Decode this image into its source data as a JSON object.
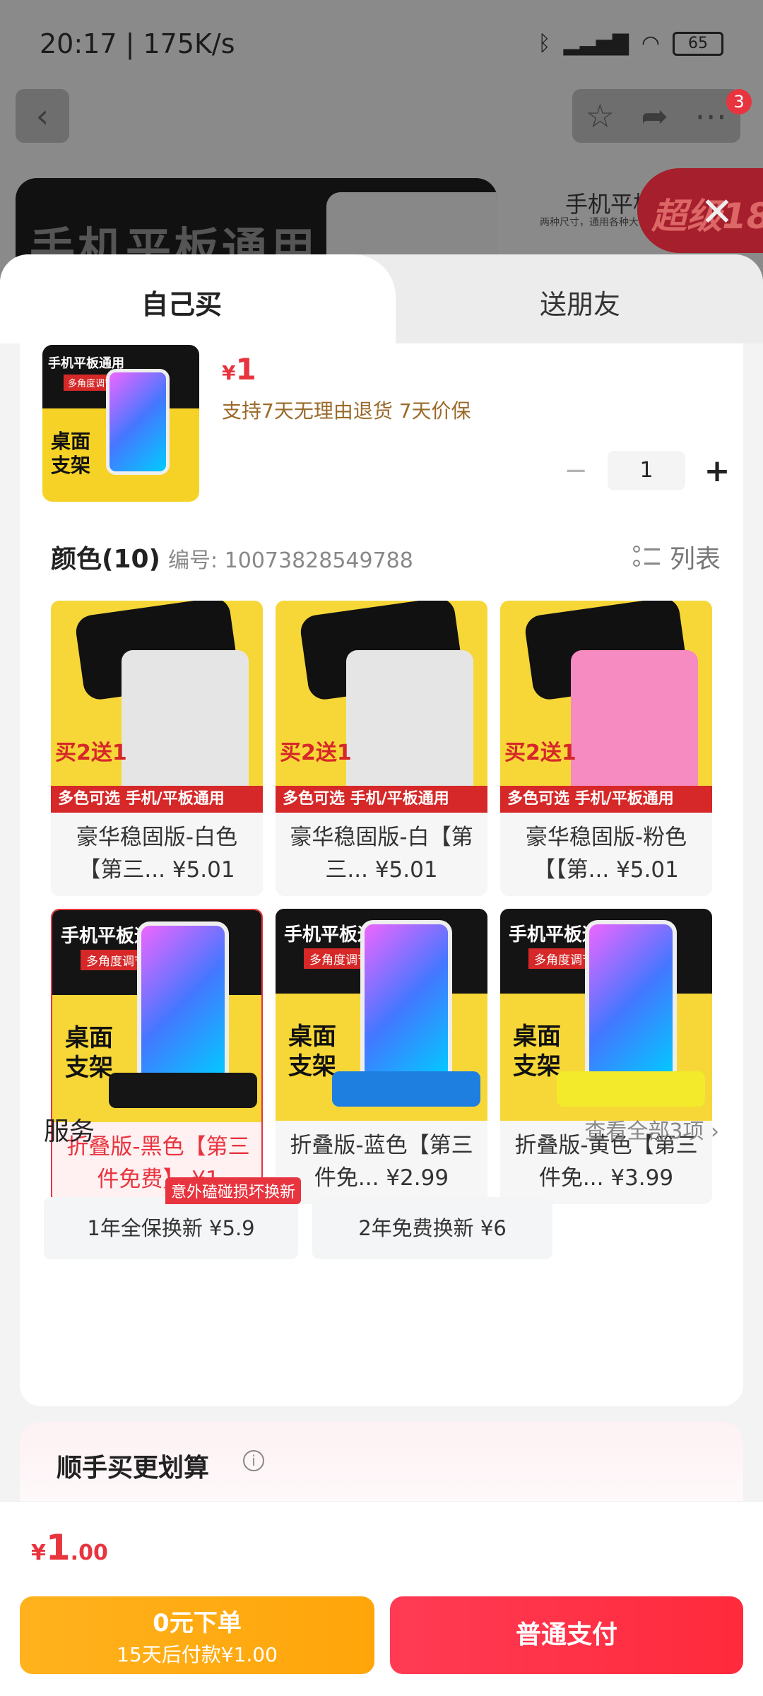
{
  "status_bar": {
    "time": "20:17 | 175K/s",
    "battery": "65"
  },
  "nav": {
    "badge_count": "3"
  },
  "hero": {
    "left_text": "手机平板通用",
    "right_title": "手机平板",
    "right_subtitle": "两种尺寸，通用各种大",
    "right_banner": "超级18"
  },
  "tabs": [
    {
      "label": "自己买"
    },
    {
      "label": "送朋友"
    }
  ],
  "product": {
    "thumb_title": "手机平板通用",
    "thumb_tag": "多角度调节",
    "thumb_caption": "桌面支架",
    "price_symbol": "¥",
    "price": "1",
    "promise": "支持7天无理由退货  7天价保",
    "quantity": "1",
    "minus": "−",
    "plus": "+"
  },
  "color_section": {
    "title": "颜色(10)",
    "code": "编号: 10073828549788",
    "list_label": "列表"
  },
  "variants": [
    {
      "label": "豪华稳固版-白色【第三... ¥5.01",
      "promo": "买2送1",
      "bar": "多色可选 手机/平板通用",
      "color": "#e5e5e5"
    },
    {
      "label": "豪华稳固版-白【第三... ¥5.01",
      "promo": "买2送1",
      "bar": "多色可选 手机/平板通用",
      "color": "#e5e5e5"
    },
    {
      "label": "豪华稳固版-粉色【【第... ¥5.01",
      "promo": "买2送1",
      "bar": "多色可选 手机/平板通用",
      "color": "#f58bc0"
    },
    {
      "label": "折叠版-黑色【第三件免费】 ¥1",
      "h1": "手机平板通用",
      "h2": "多角度调节",
      "h3": "桌面支架",
      "color": "#151515",
      "selected": true
    },
    {
      "label": "折叠版-蓝色【第三件免... ¥2.99",
      "h1": "手机平板通用",
      "h2": "多角度调节",
      "h3": "桌面支架",
      "color": "#1f7fe0"
    },
    {
      "label": "折叠版-黄色【第三件免... ¥3.99",
      "h1": "手机平板通用",
      "h2": "多角度调节",
      "h3": "桌面支架",
      "color": "#f2ea2a"
    }
  ],
  "services": {
    "title": "服务",
    "view_all": "查看全部3项  ›",
    "tag": "意外磕碰损坏换新",
    "options": [
      {
        "label": "1年全保换新  ¥5.9"
      },
      {
        "label": "2年免费换新  ¥6"
      }
    ]
  },
  "upsell": {
    "title": "顺手买更划算",
    "info": "i"
  },
  "bottom": {
    "total_symbol": "¥",
    "total_int": "1",
    "total_dec": ".00",
    "later_title": "0元下单",
    "later_sub": "15天后付款¥1.00",
    "pay_label": "普通支付"
  }
}
